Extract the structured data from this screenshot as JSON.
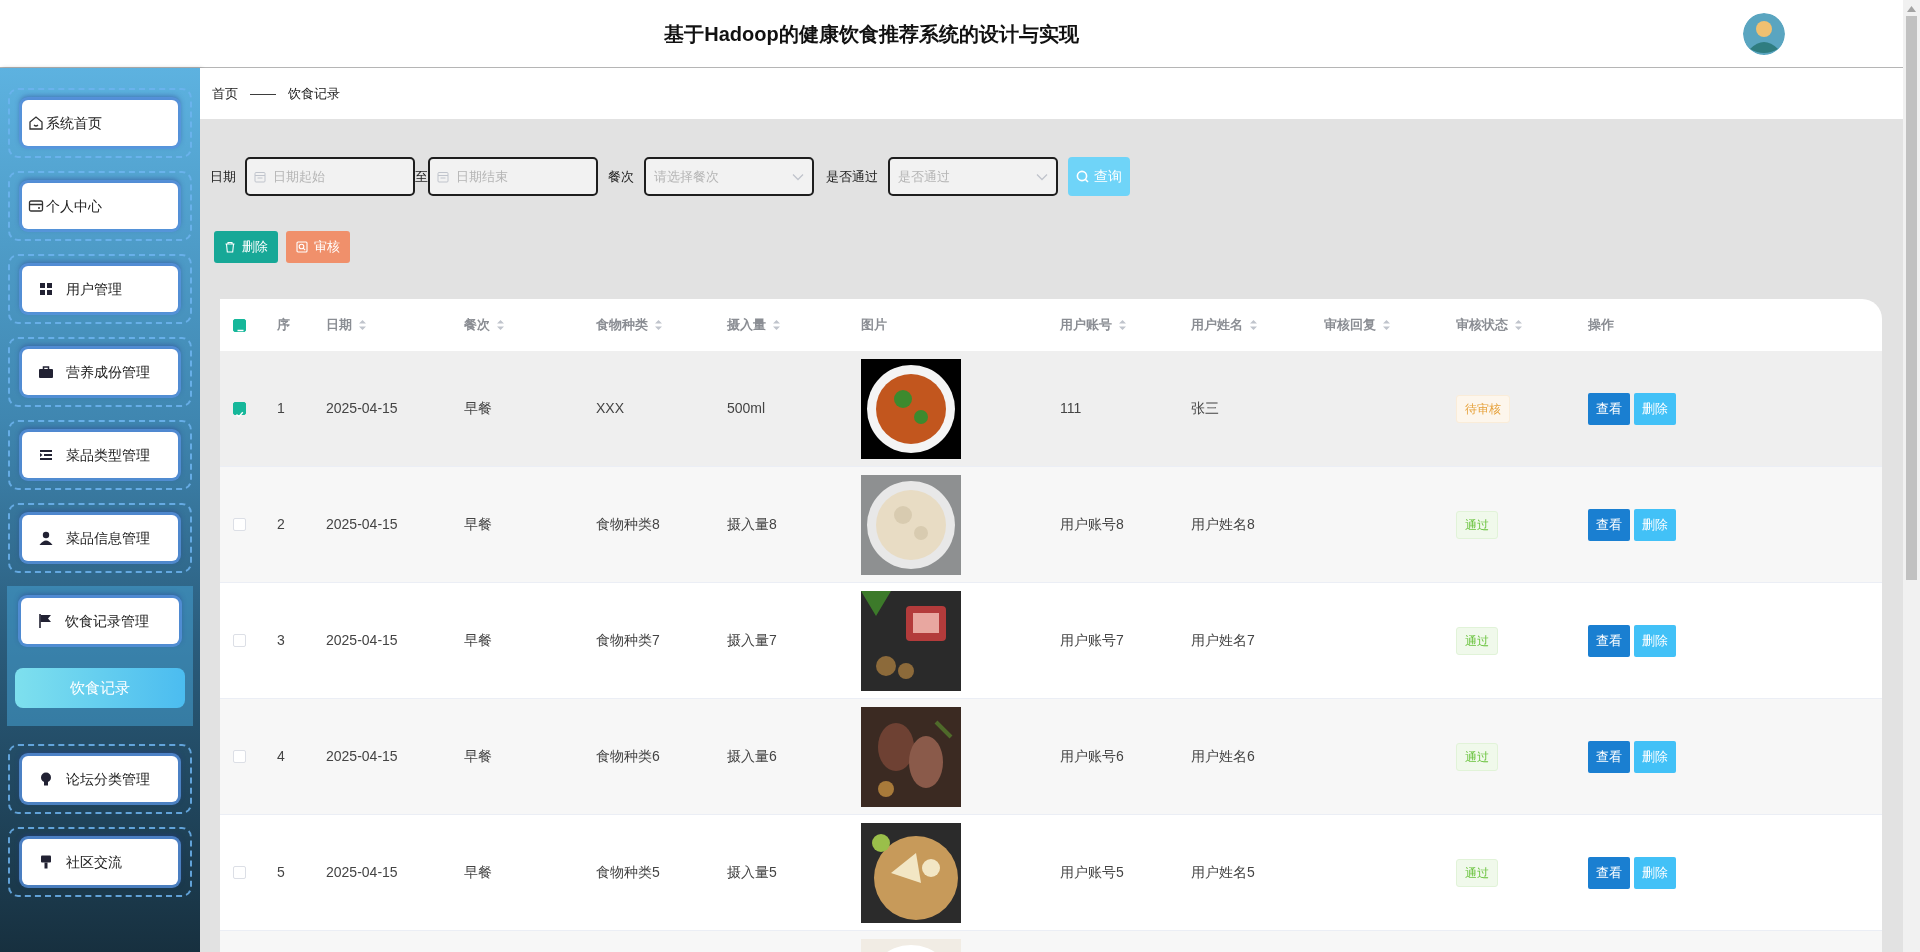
{
  "header": {
    "title": "基于Hadoop的健康饮食推荐系统的设计与实现"
  },
  "sidebar": {
    "items": [
      {
        "label": "系统首页",
        "expanded": false
      },
      {
        "label": "个人中心",
        "expanded": false
      },
      {
        "label": "用户管理",
        "expanded": false
      },
      {
        "label": "营养成份管理",
        "expanded": false
      },
      {
        "label": "菜品类型管理",
        "expanded": false
      },
      {
        "label": "菜品信息管理",
        "expanded": false
      },
      {
        "label": "饮食记录管理",
        "expanded": true,
        "children": [
          {
            "label": "饮食记录",
            "selected": true
          }
        ]
      },
      {
        "label": "论坛分类管理",
        "expanded": false
      },
      {
        "label": "社区交流",
        "expanded": false
      }
    ]
  },
  "breadcrumb": [
    "首页",
    "——",
    "饮食记录"
  ],
  "filters": {
    "date_label": "日期",
    "date_start": {
      "placeholder": "日期起始"
    },
    "date_to": "至",
    "date_end": {
      "placeholder": "日期结束"
    },
    "meal_label": "餐次",
    "meal": {
      "placeholder": "请选择餐次"
    },
    "passed_label": "是否通过",
    "passed": {
      "placeholder": "是否通过"
    },
    "search_button": "查询"
  },
  "actions": [
    {
      "label": "删除",
      "kind": "delete"
    },
    {
      "label": "审核",
      "kind": "audit"
    }
  ],
  "table": {
    "select_all": {
      "indeterminate": true
    },
    "columns": [
      {
        "label": "序",
        "sortable": false
      },
      {
        "label": "日期",
        "sortable": true
      },
      {
        "label": "餐次",
        "sortable": true
      },
      {
        "label": "食物种类",
        "sortable": true
      },
      {
        "label": "摄入量",
        "sortable": true
      },
      {
        "label": "图片",
        "sortable": false
      },
      {
        "label": "用户账号",
        "sortable": true
      },
      {
        "label": "用户姓名",
        "sortable": true
      },
      {
        "label": "审核回复",
        "sortable": true
      },
      {
        "label": "审核状态",
        "sortable": true
      },
      {
        "label": "操作",
        "sortable": false
      }
    ],
    "rows": [
      {
        "checked": true,
        "index": "1",
        "date": "2025-04-15",
        "meal": "早餐",
        "food_type": "XXX",
        "intake": "500ml",
        "image": {
          "kind": "picture"
        },
        "account": "111",
        "name": "张三",
        "status": {
          "text": "待审核",
          "kind": "pending"
        },
        "buttons": [
          "查看",
          "删除"
        ]
      },
      {
        "checked": false,
        "index": "2",
        "date": "2025-04-15",
        "meal": "早餐",
        "food_type": "食物种类8",
        "intake": "摄入量8",
        "image": {
          "kind": "picture"
        },
        "account": "用户账号8",
        "name": "用户姓名8",
        "status": {
          "text": "通过",
          "kind": "passed"
        },
        "buttons": [
          "查看",
          "删除"
        ]
      },
      {
        "checked": false,
        "index": "3",
        "date": "2025-04-15",
        "meal": "早餐",
        "food_type": "食物种类7",
        "intake": "摄入量7",
        "image": {
          "kind": "picture"
        },
        "account": "用户账号7",
        "name": "用户姓名7",
        "status": {
          "text": "通过",
          "kind": "passed"
        },
        "buttons": [
          "查看",
          "删除"
        ]
      },
      {
        "checked": false,
        "index": "4",
        "date": "2025-04-15",
        "meal": "早餐",
        "food_type": "食物种类6",
        "intake": "摄入量6",
        "image": {
          "kind": "picture"
        },
        "account": "用户账号6",
        "name": "用户姓名6",
        "status": {
          "text": "通过",
          "kind": "passed"
        },
        "buttons": [
          "查看",
          "删除"
        ]
      },
      {
        "checked": false,
        "index": "5",
        "date": "2025-04-15",
        "meal": "早餐",
        "food_type": "食物种类5",
        "intake": "摄入量5",
        "image": {
          "kind": "picture"
        },
        "account": "用户账号5",
        "name": "用户姓名5",
        "status": {
          "text": "通过",
          "kind": "passed"
        },
        "buttons": [
          "查看",
          "删除"
        ]
      },
      {
        "image": {
          "kind": "picture"
        }
      }
    ]
  }
}
